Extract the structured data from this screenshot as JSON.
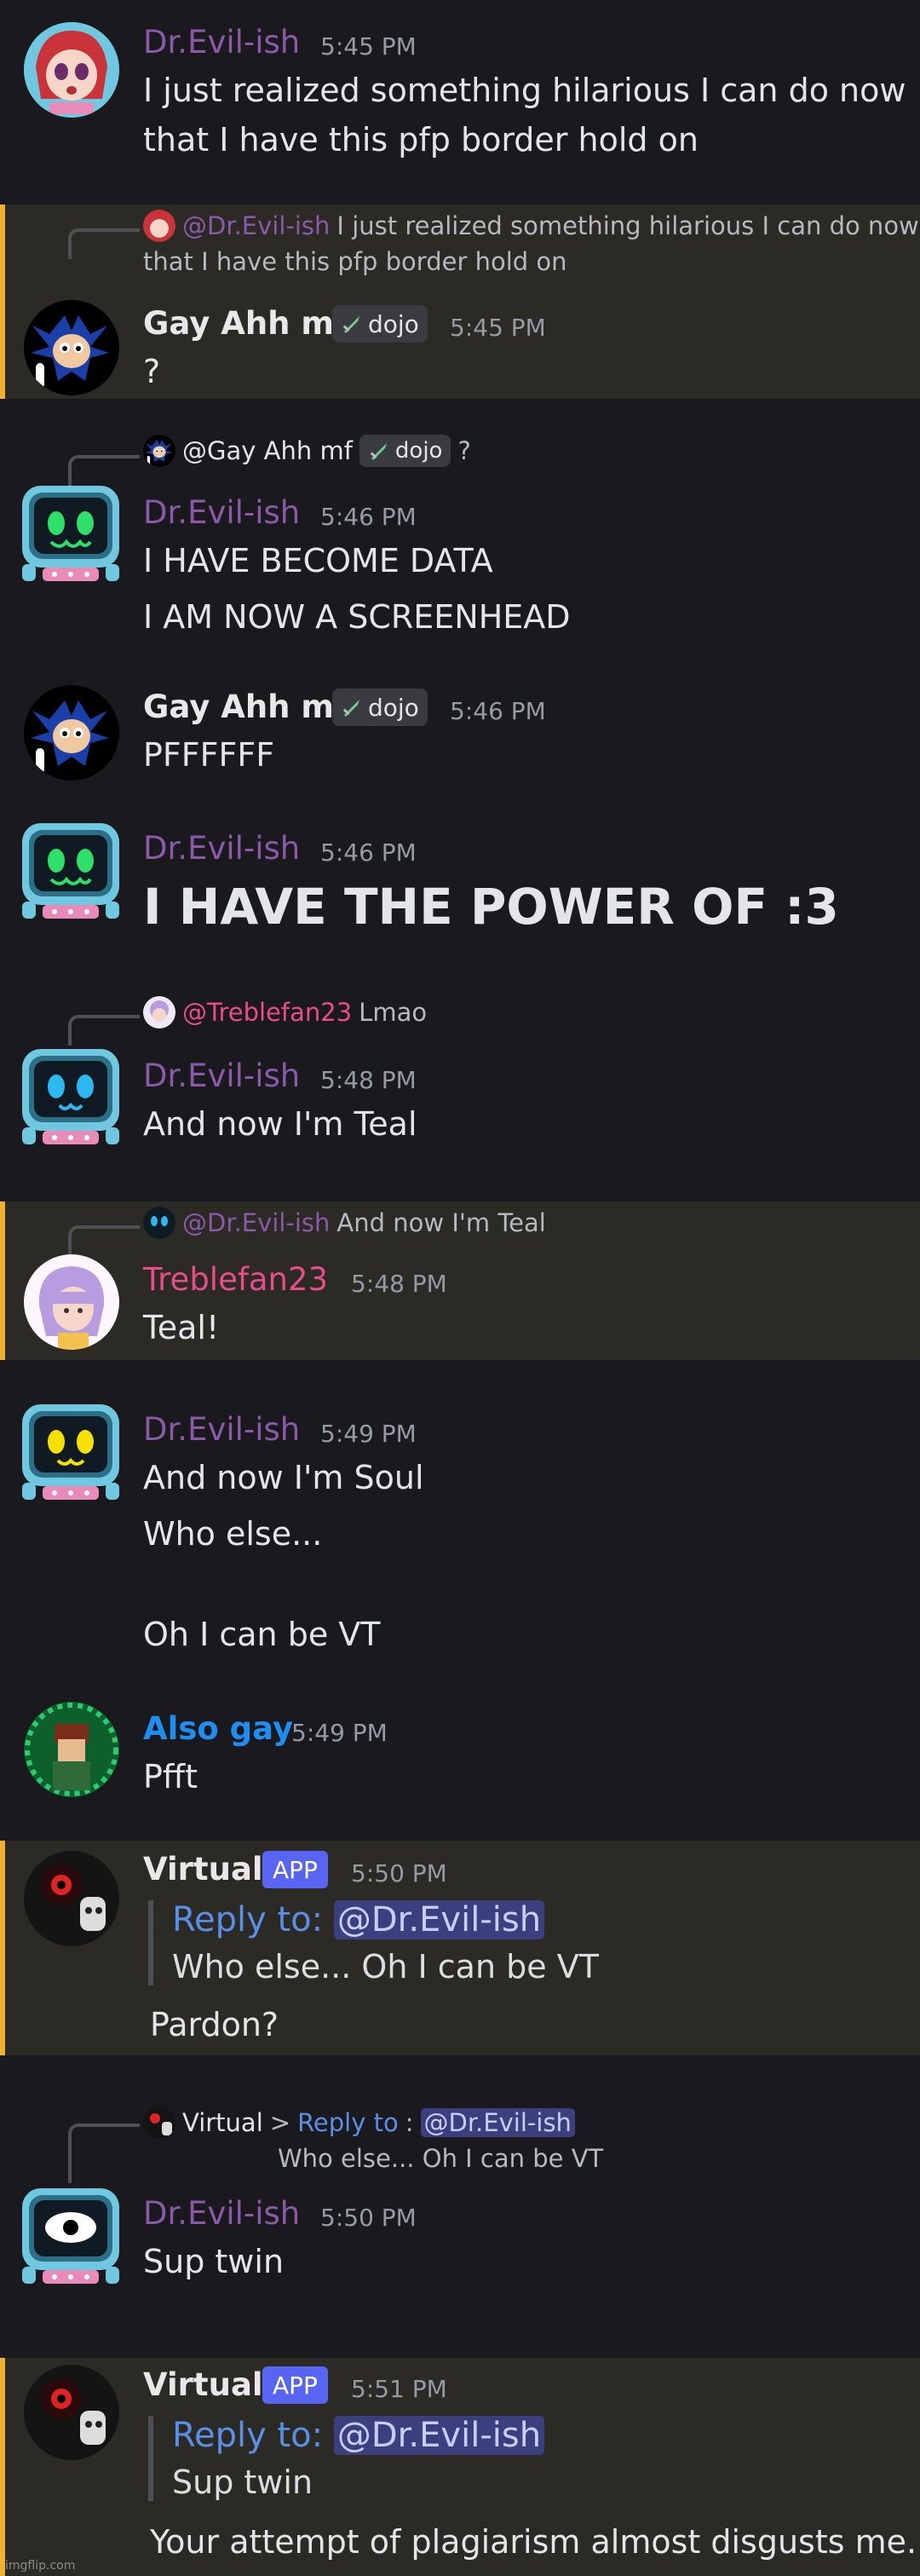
{
  "tag_label": "dojo",
  "app_badge": "APP",
  "watermark": "imgflip.com",
  "messages": [
    {
      "author": "Dr.Evil-ish",
      "time": "5:45 PM",
      "lines": [
        "I just realized something hilarious I can do now",
        "that I have this pfp border hold on"
      ]
    },
    {
      "reply_author": "@Dr.Evil-ish",
      "reply_text": "I just realized something hilarious I can do now",
      "reply_text2": "that I have this pfp border hold on",
      "author": "Gay Ahh mf",
      "time": "5:45 PM",
      "lines": [
        "?"
      ]
    },
    {
      "reply_author": "@Gay Ahh mf",
      "reply_text": "?",
      "author": "Dr.Evil-ish",
      "time": "5:46 PM",
      "lines": [
        "I HAVE BECOME DATA",
        "I AM NOW A SCREENHEAD"
      ]
    },
    {
      "author": "Gay Ahh mf",
      "time": "5:46 PM",
      "lines": [
        "PFFFFFF"
      ]
    },
    {
      "author": "Dr.Evil-ish",
      "time": "5:46 PM",
      "lines": [
        "I HAVE THE POWER OF :3"
      ]
    },
    {
      "reply_author": "@Treblefan23",
      "reply_text": "Lmao",
      "author": "Dr.Evil-ish",
      "time": "5:48 PM",
      "lines": [
        "And now I'm Teal"
      ]
    },
    {
      "reply_author": "@Dr.Evil-ish",
      "reply_text": "And now I'm Teal",
      "author": "Treblefan23",
      "time": "5:48 PM",
      "lines": [
        "Teal!"
      ]
    },
    {
      "author": "Dr.Evil-ish",
      "time": "5:49 PM",
      "lines": [
        "And now I'm Soul",
        "Who else...",
        "Oh I can be VT"
      ]
    },
    {
      "author": "Also gay",
      "time": "5:49 PM",
      "lines": [
        "Pfft"
      ]
    },
    {
      "author": "Virtual",
      "time": "5:50 PM",
      "quote_label": "Reply to",
      "quote_mention": "@Dr.Evil-ish",
      "quote_text": "Who else...  Oh I can be VT",
      "lines": [
        "Pardon?"
      ]
    },
    {
      "reply_author": "Virtual",
      "reply_sep": ">",
      "reply_label": "Reply to",
      "reply_mention": "@Dr.Evil-ish",
      "reply_text2": "Who else...  Oh I can be VT",
      "author": "Dr.Evil-ish",
      "time": "5:50 PM",
      "lines": [
        "Sup twin"
      ]
    },
    {
      "author": "Virtual",
      "time": "5:51 PM",
      "quote_label": "Reply to",
      "quote_mention": "@Dr.Evil-ish",
      "quote_text": "Sup twin",
      "lines": [
        "Your attempt of plagiarism almost disgusts me..."
      ]
    }
  ],
  "colors": {
    "background": "#1a1a1e",
    "highlight": "#2b2a25",
    "highlight_bar": "#f0b232",
    "purple_name": "#8a5aa8",
    "pink_name": "#e94c8a",
    "blue_name": "#1f8ef1",
    "app_badge": "#5865f2",
    "link": "#5a8fe6"
  }
}
